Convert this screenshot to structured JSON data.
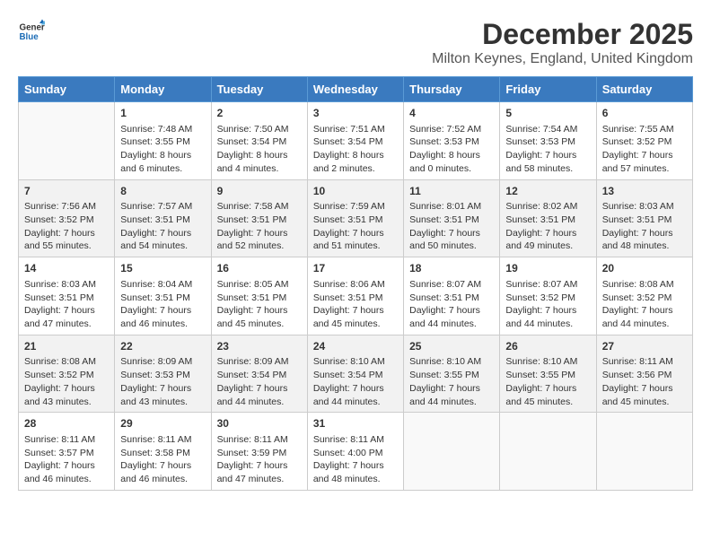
{
  "logo": {
    "name_line1": "General",
    "name_line2": "Blue"
  },
  "title": "December 2025",
  "location": "Milton Keynes, England, United Kingdom",
  "days_of_week": [
    "Sunday",
    "Monday",
    "Tuesday",
    "Wednesday",
    "Thursday",
    "Friday",
    "Saturday"
  ],
  "weeks": [
    [
      {
        "day": "",
        "info": ""
      },
      {
        "day": "1",
        "info": "Sunrise: 7:48 AM\nSunset: 3:55 PM\nDaylight: 8 hours\nand 6 minutes."
      },
      {
        "day": "2",
        "info": "Sunrise: 7:50 AM\nSunset: 3:54 PM\nDaylight: 8 hours\nand 4 minutes."
      },
      {
        "day": "3",
        "info": "Sunrise: 7:51 AM\nSunset: 3:54 PM\nDaylight: 8 hours\nand 2 minutes."
      },
      {
        "day": "4",
        "info": "Sunrise: 7:52 AM\nSunset: 3:53 PM\nDaylight: 8 hours\nand 0 minutes."
      },
      {
        "day": "5",
        "info": "Sunrise: 7:54 AM\nSunset: 3:53 PM\nDaylight: 7 hours\nand 58 minutes."
      },
      {
        "day": "6",
        "info": "Sunrise: 7:55 AM\nSunset: 3:52 PM\nDaylight: 7 hours\nand 57 minutes."
      }
    ],
    [
      {
        "day": "7",
        "info": "Sunrise: 7:56 AM\nSunset: 3:52 PM\nDaylight: 7 hours\nand 55 minutes."
      },
      {
        "day": "8",
        "info": "Sunrise: 7:57 AM\nSunset: 3:51 PM\nDaylight: 7 hours\nand 54 minutes."
      },
      {
        "day": "9",
        "info": "Sunrise: 7:58 AM\nSunset: 3:51 PM\nDaylight: 7 hours\nand 52 minutes."
      },
      {
        "day": "10",
        "info": "Sunrise: 7:59 AM\nSunset: 3:51 PM\nDaylight: 7 hours\nand 51 minutes."
      },
      {
        "day": "11",
        "info": "Sunrise: 8:01 AM\nSunset: 3:51 PM\nDaylight: 7 hours\nand 50 minutes."
      },
      {
        "day": "12",
        "info": "Sunrise: 8:02 AM\nSunset: 3:51 PM\nDaylight: 7 hours\nand 49 minutes."
      },
      {
        "day": "13",
        "info": "Sunrise: 8:03 AM\nSunset: 3:51 PM\nDaylight: 7 hours\nand 48 minutes."
      }
    ],
    [
      {
        "day": "14",
        "info": "Sunrise: 8:03 AM\nSunset: 3:51 PM\nDaylight: 7 hours\nand 47 minutes."
      },
      {
        "day": "15",
        "info": "Sunrise: 8:04 AM\nSunset: 3:51 PM\nDaylight: 7 hours\nand 46 minutes."
      },
      {
        "day": "16",
        "info": "Sunrise: 8:05 AM\nSunset: 3:51 PM\nDaylight: 7 hours\nand 45 minutes."
      },
      {
        "day": "17",
        "info": "Sunrise: 8:06 AM\nSunset: 3:51 PM\nDaylight: 7 hours\nand 45 minutes."
      },
      {
        "day": "18",
        "info": "Sunrise: 8:07 AM\nSunset: 3:51 PM\nDaylight: 7 hours\nand 44 minutes."
      },
      {
        "day": "19",
        "info": "Sunrise: 8:07 AM\nSunset: 3:52 PM\nDaylight: 7 hours\nand 44 minutes."
      },
      {
        "day": "20",
        "info": "Sunrise: 8:08 AM\nSunset: 3:52 PM\nDaylight: 7 hours\nand 44 minutes."
      }
    ],
    [
      {
        "day": "21",
        "info": "Sunrise: 8:08 AM\nSunset: 3:52 PM\nDaylight: 7 hours\nand 43 minutes."
      },
      {
        "day": "22",
        "info": "Sunrise: 8:09 AM\nSunset: 3:53 PM\nDaylight: 7 hours\nand 43 minutes."
      },
      {
        "day": "23",
        "info": "Sunrise: 8:09 AM\nSunset: 3:54 PM\nDaylight: 7 hours\nand 44 minutes."
      },
      {
        "day": "24",
        "info": "Sunrise: 8:10 AM\nSunset: 3:54 PM\nDaylight: 7 hours\nand 44 minutes."
      },
      {
        "day": "25",
        "info": "Sunrise: 8:10 AM\nSunset: 3:55 PM\nDaylight: 7 hours\nand 44 minutes."
      },
      {
        "day": "26",
        "info": "Sunrise: 8:10 AM\nSunset: 3:55 PM\nDaylight: 7 hours\nand 45 minutes."
      },
      {
        "day": "27",
        "info": "Sunrise: 8:11 AM\nSunset: 3:56 PM\nDaylight: 7 hours\nand 45 minutes."
      }
    ],
    [
      {
        "day": "28",
        "info": "Sunrise: 8:11 AM\nSunset: 3:57 PM\nDaylight: 7 hours\nand 46 minutes."
      },
      {
        "day": "29",
        "info": "Sunrise: 8:11 AM\nSunset: 3:58 PM\nDaylight: 7 hours\nand 46 minutes."
      },
      {
        "day": "30",
        "info": "Sunrise: 8:11 AM\nSunset: 3:59 PM\nDaylight: 7 hours\nand 47 minutes."
      },
      {
        "day": "31",
        "info": "Sunrise: 8:11 AM\nSunset: 4:00 PM\nDaylight: 7 hours\nand 48 minutes."
      },
      {
        "day": "",
        "info": ""
      },
      {
        "day": "",
        "info": ""
      },
      {
        "day": "",
        "info": ""
      }
    ]
  ]
}
